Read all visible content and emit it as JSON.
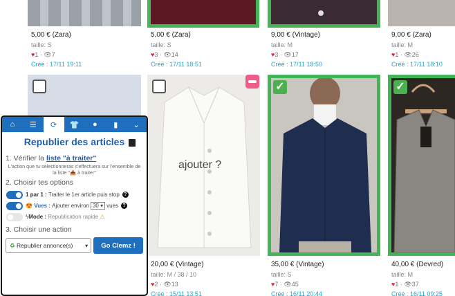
{
  "top_cards": [
    {
      "price": "5,00 € (Zara)",
      "size": "taille: S",
      "stats": "1 · 👁7",
      "created": "Créé : 17/11 19:11"
    },
    {
      "price": "5,00 € (Zara)",
      "size": "taille: S",
      "stats": "3 · 👁14",
      "created": "Créé : 17/11 18:51"
    },
    {
      "price": "9,00 € (Vintage)",
      "size": "taille: M",
      "stats": "3 · 👁17",
      "created": "Créé : 17/11 18:50"
    },
    {
      "price": "9,00 € (Zara)",
      "size": "taille: M",
      "stats": "1 · 👁26",
      "created": "Créé : 17/11 18:10"
    }
  ],
  "bottom_cards": [
    {
      "price": "20,00 € (Vintage)",
      "size": "taille: M / 38 / 10",
      "stats": "2 · 👁13",
      "created": "Créé : 15/11 13:51"
    },
    {
      "price": "35,00 € (Vintage)",
      "size": "taille: S",
      "stats": "7 · 👁45",
      "created": "Créé : 16/11 20:44"
    },
    {
      "price": "40,00 € (Devred)",
      "size": "taille: M",
      "stats": "1 · 👁37",
      "created": "Créé : 16/11 09:25"
    }
  ],
  "overlay": {
    "add_label": "ajouter ?"
  },
  "panel": {
    "title": "Republier des articles",
    "step1_prefix": "1. Vérifier la ",
    "step1_link": "liste \"à traiter\"",
    "step1_note": "L'action que tu sélectionneras s'effectuera sur l'ensemble de la liste \"📤 à traiter\"",
    "step2": "2. Choisir tes options",
    "opt1_bold": "1 par 1 :",
    "opt1_text": "Traiter le 1er article puis stop",
    "opt2_bold": "Vues :",
    "opt2_text": "Ajouter environ",
    "opt2_value": "30",
    "opt2_unit": "vues",
    "opt3_bold": "Mode :",
    "opt3_text": "Republication rapide",
    "step3": "3. Choisir une action",
    "action_value": "Republier annonce(s)",
    "go_label": "Go Clemz !"
  },
  "colors": {
    "accent": "#1f6fbf",
    "selected_border": "#44b556",
    "created_text": "#1aa7cf"
  }
}
